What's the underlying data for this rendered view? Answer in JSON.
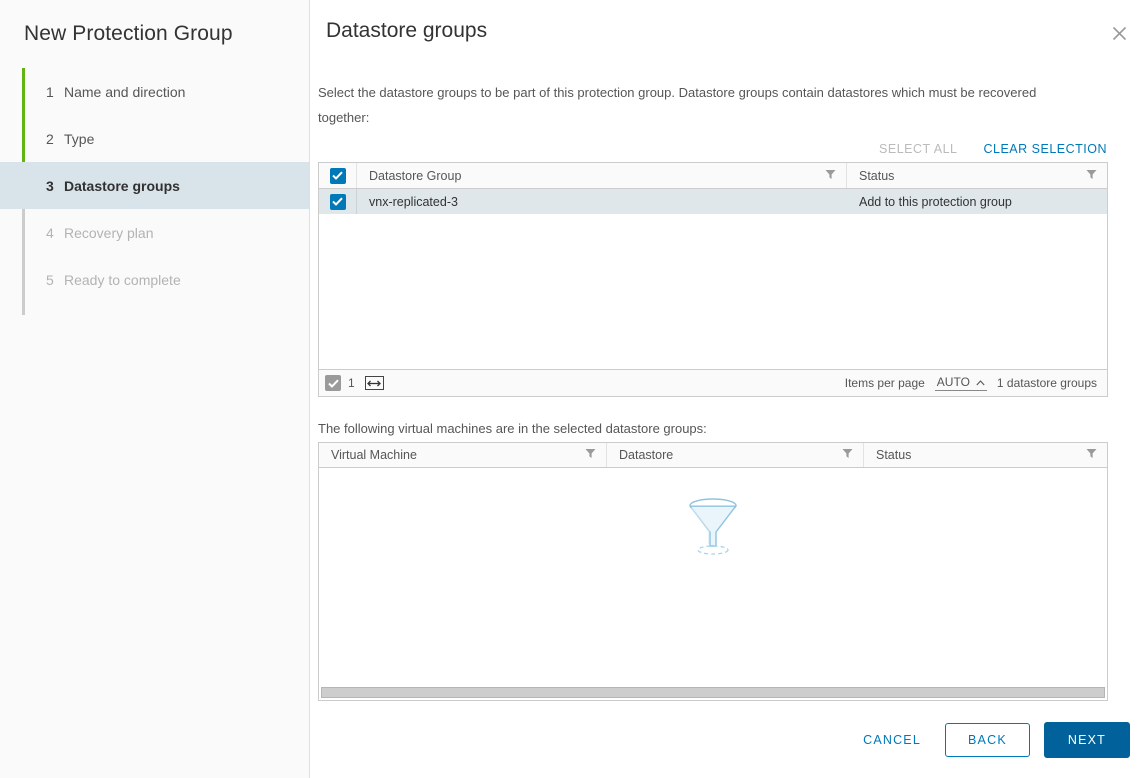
{
  "sidebar": {
    "title": "New Protection Group",
    "steps": [
      {
        "num": "1",
        "label": "Name and direction",
        "state": "done"
      },
      {
        "num": "2",
        "label": "Type",
        "state": "done"
      },
      {
        "num": "3",
        "label": "Datastore groups",
        "state": "active"
      },
      {
        "num": "4",
        "label": "Recovery plan",
        "state": "disabled"
      },
      {
        "num": "5",
        "label": "Ready to complete",
        "state": "disabled"
      }
    ]
  },
  "main": {
    "page_title": "Datastore groups",
    "close_icon": "close-icon",
    "description": "Select the datastore groups to be part of this protection group. Datastore groups contain datastores which must be recovered together:",
    "select_all_label": "SELECT ALL",
    "clear_selection_label": "CLEAR SELECTION"
  },
  "datastore_grid": {
    "columns": [
      {
        "label": "Datastore Group",
        "filter_icon": "filter-icon"
      },
      {
        "label": "Status",
        "filter_icon": "filter-icon"
      }
    ],
    "rows": [
      {
        "name": "vnx-replicated-3",
        "status": "Add to this protection group",
        "selected": true
      }
    ],
    "footer": {
      "selected_count": "1",
      "fit_columns_icon": "fit-columns-icon",
      "items_per_page_label": "Items per page",
      "items_per_page_value": "AUTO",
      "total_label": "1 datastore groups"
    }
  },
  "vm_section": {
    "description": "The following virtual machines are in the selected datastore groups:",
    "columns": [
      {
        "label": "Virtual Machine",
        "filter_icon": "filter-icon"
      },
      {
        "label": "Datastore",
        "filter_icon": "filter-icon"
      },
      {
        "label": "Status",
        "filter_icon": "filter-icon"
      }
    ],
    "rows": [],
    "empty_icon": "funnel-icon"
  },
  "footer": {
    "cancel_label": "CANCEL",
    "back_label": "BACK",
    "next_label": "NEXT"
  },
  "colors": {
    "accent": "#0079b8",
    "primary_button": "#00619b",
    "progress_green": "#60b515",
    "selected_row": "#dfe7eb",
    "active_step": "#d9e4ea"
  }
}
